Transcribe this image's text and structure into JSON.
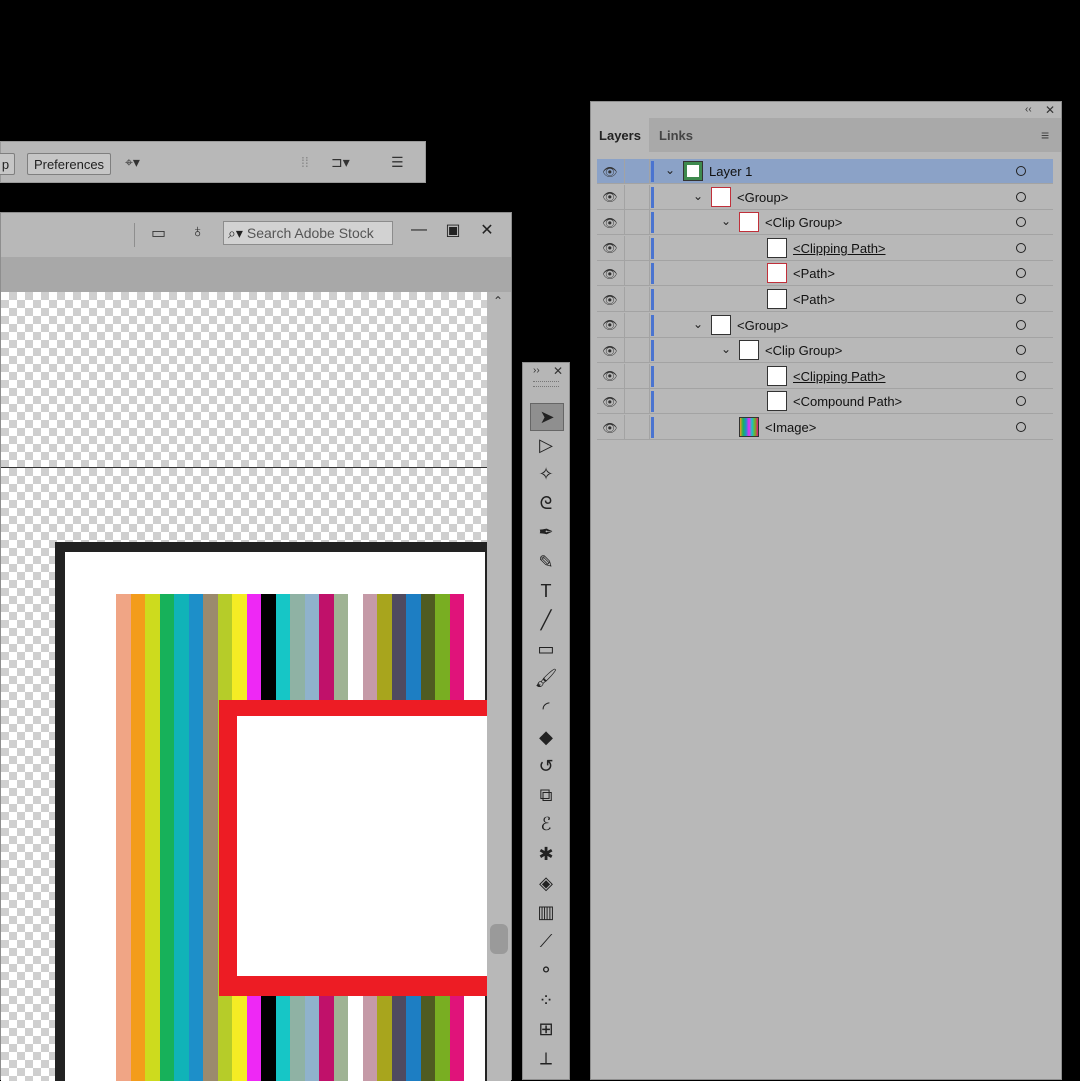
{
  "control_bar": {
    "partial_button_label": "p",
    "preferences_label": "Preferences"
  },
  "document": {
    "search_placeholder": "Search Adobe Stock"
  },
  "artwork": {
    "stripe_colors": [
      "#f0a585",
      "#f39c1b",
      "#cddb1e",
      "#17b15a",
      "#10b3b8",
      "#1d8fc9",
      "#9b8a6d",
      "#b6cc29",
      "#f5ec24",
      "#ee28f5",
      "#000000",
      "#16c6c6",
      "#8fb2a4",
      "#8fb2cc",
      "#c0116a",
      "#9fb394",
      "#ffffff",
      "#c59aa7",
      "#a8a51d",
      "#4f4a5f",
      "#1d7ec3",
      "#4f5b21",
      "#79ae22",
      "#e0137a"
    ],
    "frame_color": "#222222",
    "red_color": "#ed1c24"
  },
  "layers_panel": {
    "tabs": [
      {
        "label": "Layers",
        "active": true
      },
      {
        "label": "Links",
        "active": false
      }
    ],
    "rows": [
      {
        "label": "Layer 1",
        "indent": 0,
        "expanded": true,
        "selected": true,
        "thumb": "layer",
        "underline": false
      },
      {
        "label": "<Group>",
        "indent": 1,
        "expanded": true,
        "selected": false,
        "thumb": "red",
        "underline": false
      },
      {
        "label": "<Clip Group>",
        "indent": 2,
        "expanded": true,
        "selected": false,
        "thumb": "red",
        "underline": false
      },
      {
        "label": "<Clipping Path>",
        "indent": 3,
        "expanded": false,
        "selected": false,
        "thumb": "white",
        "underline": true
      },
      {
        "label": "<Path>",
        "indent": 3,
        "expanded": false,
        "selected": false,
        "thumb": "red",
        "underline": false
      },
      {
        "label": "<Path>",
        "indent": 3,
        "expanded": false,
        "selected": false,
        "thumb": "white",
        "underline": false
      },
      {
        "label": "<Group>",
        "indent": 1,
        "expanded": true,
        "selected": false,
        "thumb": "white",
        "underline": false
      },
      {
        "label": "<Clip Group>",
        "indent": 2,
        "expanded": true,
        "selected": false,
        "thumb": "white",
        "underline": false
      },
      {
        "label": "<Clipping Path>",
        "indent": 3,
        "expanded": false,
        "selected": false,
        "thumb": "white",
        "underline": true
      },
      {
        "label": "<Compound Path>",
        "indent": 3,
        "expanded": false,
        "selected": false,
        "thumb": "white",
        "underline": false
      },
      {
        "label": "<Image>",
        "indent": 2,
        "expanded": false,
        "selected": false,
        "thumb": "image",
        "underline": false
      }
    ]
  },
  "tools": [
    "selection-tool",
    "direct-selection-tool",
    "magic-wand-tool",
    "lasso-tool",
    "pen-tool",
    "curvature-tool",
    "type-tool",
    "line-segment-tool",
    "rectangle-tool",
    "paintbrush-tool",
    "shaper-tool",
    "eraser-tool",
    "rotate-tool",
    "scale-tool",
    "warp-tool",
    "puppet-warp-tool",
    "shape-builder-tool",
    "gradient-tool",
    "eyedropper-tool",
    "blend-tool",
    "symbol-sprayer-tool",
    "artboard-tool",
    "slice-tool"
  ]
}
